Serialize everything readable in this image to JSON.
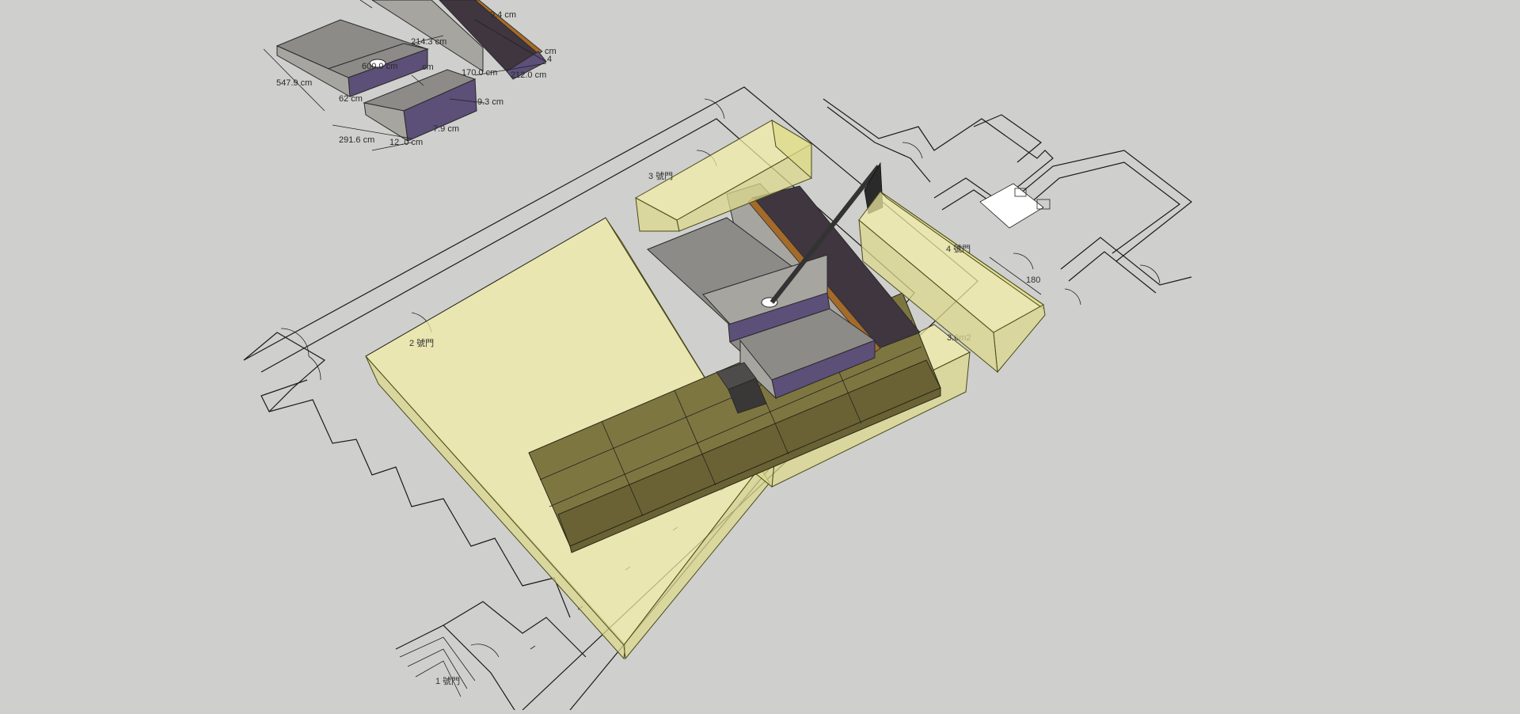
{
  "dimensions": {
    "d1": "9.4 cm",
    "d2": "214.3 cm",
    "d3": "600.0 cm",
    "d4": "cm",
    "d5": "170.0 cm",
    "d6": "212.0 cm",
    "d7": "547.9 cm",
    "d8": "62 cm",
    "d9": "9.3 cm",
    "d10": "7.9 cm",
    "d11": "291.6 cm",
    "d12": "12 .0 cm",
    "d13": "cm",
    "d14": "4"
  },
  "labels": {
    "door1": "1 號門",
    "door2": "2 號門",
    "door3": "3 號門",
    "door4": "4 號門",
    "dim180": "180",
    "area": "3.6m2"
  },
  "colors": {
    "background": "#cfcfcd",
    "zone_fill": "#f2efa6",
    "concrete": "#8d8b87",
    "purple_accent": "#5c4f78",
    "gravel": "#3f3640",
    "mat": "#7e7640"
  }
}
